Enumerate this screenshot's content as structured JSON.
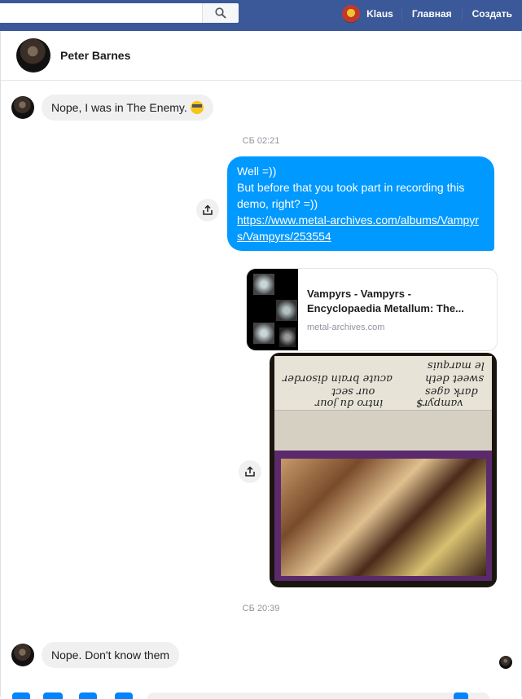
{
  "topbar": {
    "search_placeholder": "",
    "user_name": "Klaus",
    "nav_home": "Главная",
    "nav_create": "Создать",
    "brand_color": "#3b5998"
  },
  "conversation": {
    "contact_name": "Peter Barnes"
  },
  "messages": {
    "incoming_1": "Nope, I was in The Enemy.",
    "timestamp_1": "СБ 02:21",
    "outgoing_line_1": "Well =))",
    "outgoing_line_2": "But before that you took part in recording this demo, right? =))",
    "outgoing_link": "https://www.metal-archives.com/albums/Vampyrs/Vampyrs/253554",
    "link_preview_title": "Vampyrs - Vampyrs - Encyclopaedia Metallum: The...",
    "link_preview_domain": "metal-archives.com",
    "photo_tracks": [
      "intro du jour",
      "our sect",
      "acute brain disorder",
      "vampyr$",
      "dark ages",
      "sweet deth",
      "le marquis"
    ],
    "timestamp_2": "СБ 20:39",
    "incoming_2": "Nope. Don't know them",
    "outgoing_color": "#0099ff"
  },
  "icons": {
    "search": "search-icon",
    "share": "share-icon",
    "emoji": "nerd-face-emoji"
  }
}
